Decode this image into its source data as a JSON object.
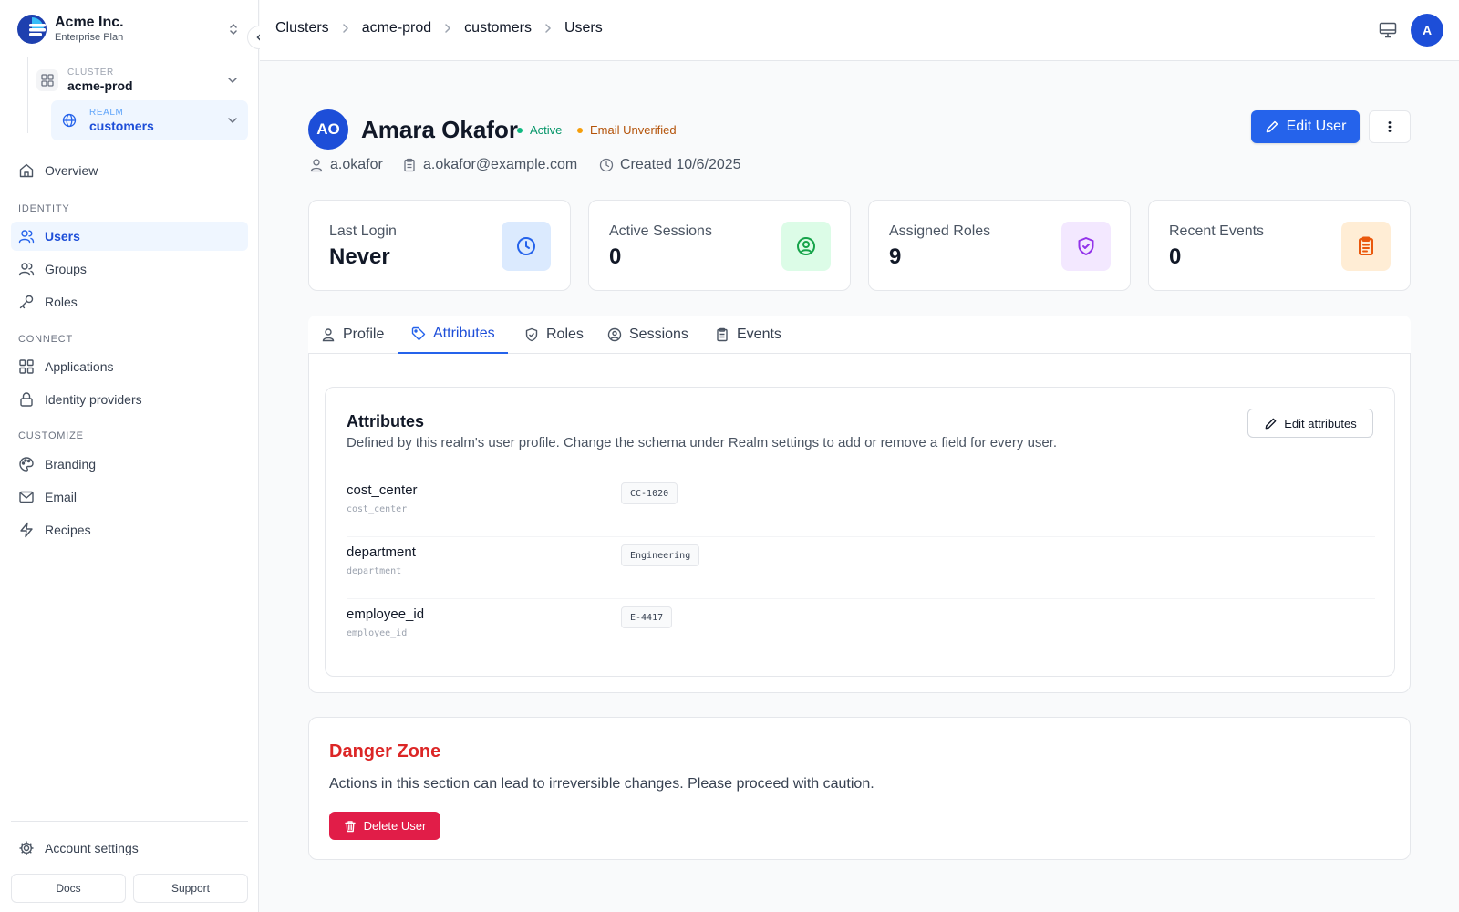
{
  "org": {
    "name": "Acme Inc.",
    "plan": "Enterprise Plan"
  },
  "cluster": {
    "label": "CLUSTER",
    "value": "acme-prod"
  },
  "realm": {
    "label": "REALM",
    "value": "customers"
  },
  "nav": {
    "overview": "Overview",
    "sections": {
      "identity": "IDENTITY",
      "connect": "CONNECT",
      "customize": "CUSTOMIZE"
    },
    "users": "Users",
    "groups": "Groups",
    "roles": "Roles",
    "applications": "Applications",
    "identity_providers": "Identity providers",
    "branding": "Branding",
    "email": "Email",
    "recipes": "Recipes",
    "account_settings": "Account settings",
    "docs": "Docs",
    "support": "Support"
  },
  "breadcrumbs": [
    "Clusters",
    "acme-prod",
    "customers",
    "Users"
  ],
  "header": {
    "avatar_initial": "A"
  },
  "user": {
    "initials": "AO",
    "name": "Amara Okafor",
    "status_active": "Active",
    "status_email": "Email Unverified",
    "username": "a.okafor",
    "email": "a.okafor@example.com",
    "created": "Created 10/6/2025"
  },
  "actions": {
    "edit_user": "Edit User",
    "edit_attributes": "Edit attributes",
    "delete_user": "Delete User"
  },
  "stats": [
    {
      "label": "Last Login",
      "value": "Never",
      "icon": "clock-icon"
    },
    {
      "label": "Active Sessions",
      "value": "0",
      "icon": "user-circle-icon"
    },
    {
      "label": "Assigned Roles",
      "value": "9",
      "icon": "shield-check-icon"
    },
    {
      "label": "Recent Events",
      "value": "0",
      "icon": "clipboard-icon"
    }
  ],
  "tabs": [
    "Profile",
    "Attributes",
    "Roles",
    "Sessions",
    "Events"
  ],
  "attributes": {
    "title": "Attributes",
    "description": "Defined by this realm's user profile. Change the schema under Realm settings to add or remove a field for every user.",
    "rows": [
      {
        "name": "cost_center",
        "key": "cost_center",
        "value": "CC-1020"
      },
      {
        "name": "department",
        "key": "department",
        "value": "Engineering"
      },
      {
        "name": "employee_id",
        "key": "employee_id",
        "value": "E-4417"
      }
    ]
  },
  "danger": {
    "title": "Danger Zone",
    "description": "Actions in this section can lead to irreversible changes. Please proceed with caution."
  },
  "colors": {
    "primary": "#2563eb",
    "active": "#059669",
    "warning": "#d97706",
    "danger": "#dc2626"
  }
}
